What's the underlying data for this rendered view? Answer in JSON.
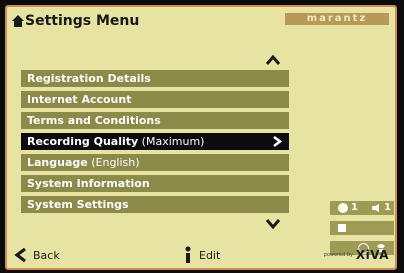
{
  "header": {
    "title": "Settings Menu",
    "brand": "marantz"
  },
  "menu": {
    "items": [
      {
        "label": "Registration Details",
        "value": ""
      },
      {
        "label": "Internet Account",
        "value": ""
      },
      {
        "label": "Terms and Conditions",
        "value": ""
      },
      {
        "label": "Recording Quality",
        "value": " (Maximum)"
      },
      {
        "label": "Language",
        "value": " (English)"
      },
      {
        "label": "System Information",
        "value": ""
      },
      {
        "label": "System Settings",
        "value": ""
      }
    ],
    "selected_index": 3
  },
  "side_panel": {
    "info_count": "1",
    "volume": "1"
  },
  "footer": {
    "back_label": "Back",
    "edit_label": "Edit",
    "xiva_label": "XiVA",
    "xiva_tag": "powered by"
  },
  "colors": {
    "background": "#e7e3a2",
    "menu_item": "#8c8a48",
    "menu_selected": "#0c0c0c",
    "border": "#d08a5a"
  }
}
